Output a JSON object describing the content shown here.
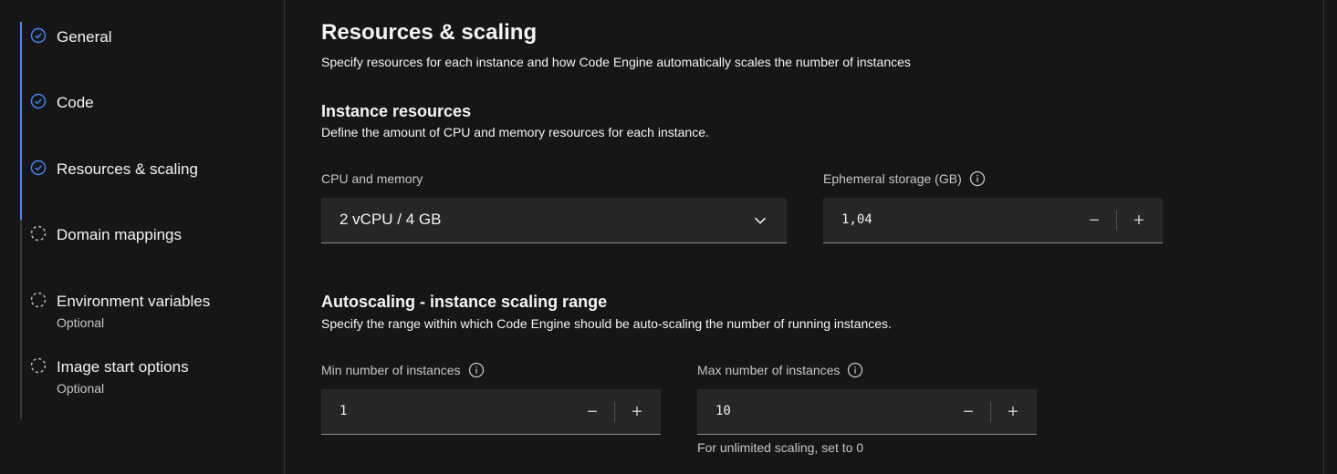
{
  "sidebar": {
    "steps": [
      {
        "label": "General",
        "sub": "",
        "status": "complete"
      },
      {
        "label": "Code",
        "sub": "",
        "status": "complete"
      },
      {
        "label": "Resources & scaling",
        "sub": "",
        "status": "complete"
      },
      {
        "label": "Domain mappings",
        "sub": "",
        "status": "incomplete"
      },
      {
        "label": "Environment variables",
        "sub": "Optional",
        "status": "incomplete"
      },
      {
        "label": "Image start options",
        "sub": "Optional",
        "status": "incomplete"
      }
    ]
  },
  "main": {
    "title": "Resources & scaling",
    "description": "Specify resources for each instance and how Code Engine automatically scales the number of instances",
    "instance_resources": {
      "title": "Instance resources",
      "description": "Define the amount of CPU and memory resources for each instance.",
      "cpu_memory": {
        "label": "CPU and memory",
        "value": "2 vCPU / 4 GB"
      },
      "ephemeral_storage": {
        "label": "Ephemeral storage (GB)",
        "value": "1,04"
      }
    },
    "autoscaling": {
      "title": "Autoscaling - instance scaling range",
      "description": "Specify the range within which Code Engine should be auto-scaling the number of running instances.",
      "min_instances": {
        "label": "Min number of instances",
        "value": "1"
      },
      "max_instances": {
        "label": "Max number of instances",
        "value": "10",
        "helper": "For unlimited scaling, set to 0"
      }
    },
    "stepper": {
      "decrement": "−",
      "increment": "+"
    }
  },
  "colors": {
    "background": "#161616",
    "field": "#262626",
    "accent": "#4589ff",
    "text": "#f4f4f4",
    "muted": "#c6c6c6"
  },
  "icons": {
    "complete_step": "checkmark-outline-icon",
    "incomplete_step": "circle-dash-icon",
    "info": "information-icon",
    "dropdown": "chevron-down-icon"
  }
}
